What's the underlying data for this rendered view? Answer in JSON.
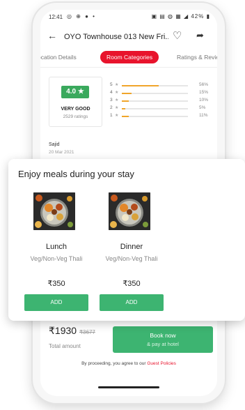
{
  "status_bar": {
    "time": "12:41",
    "battery": "42%"
  },
  "header": {
    "title": "OYO Townhouse 013 New Fri..."
  },
  "tabs": [
    {
      "label": "ocation Details"
    },
    {
      "label": "Room Categories"
    },
    {
      "label": "Ratings & Revie"
    }
  ],
  "rating": {
    "score": "4.0 ★",
    "label": "VERY GOOD",
    "count": "2529 ratings",
    "distribution": [
      {
        "star": "5",
        "pct_text": "56%",
        "fraction": 0.56
      },
      {
        "star": "4",
        "pct_text": "15%",
        "fraction": 0.15
      },
      {
        "star": "3",
        "pct_text": "10%",
        "fraction": 0.1
      },
      {
        "star": "2",
        "pct_text": "5%",
        "fraction": 0.05
      },
      {
        "star": "1",
        "pct_text": "11%",
        "fraction": 0.11
      }
    ]
  },
  "review": {
    "name": "Sajid",
    "date": "20 Mar 2021"
  },
  "meals": {
    "heading": "Enjoy meals during your stay",
    "items": [
      {
        "name": "Lunch",
        "desc": "Veg/Non-Veg Thali",
        "price": "₹350",
        "button": "ADD"
      },
      {
        "name": "Dinner",
        "desc": "Veg/Non-Veg Thali",
        "price": "₹350",
        "button": "ADD"
      }
    ]
  },
  "booking": {
    "price": "₹1930",
    "original_price": "₹3677",
    "total_label": "Total amount",
    "button_line1": "Book now",
    "button_line2": "& pay at hotel"
  },
  "policy": {
    "text": "By proceeding, you agree to our ",
    "link": "Guest Policies"
  },
  "colors": {
    "accent": "#e8132c",
    "green": "#3db471",
    "rating_green": "#3aa95d",
    "bar": "#f0a52a"
  }
}
